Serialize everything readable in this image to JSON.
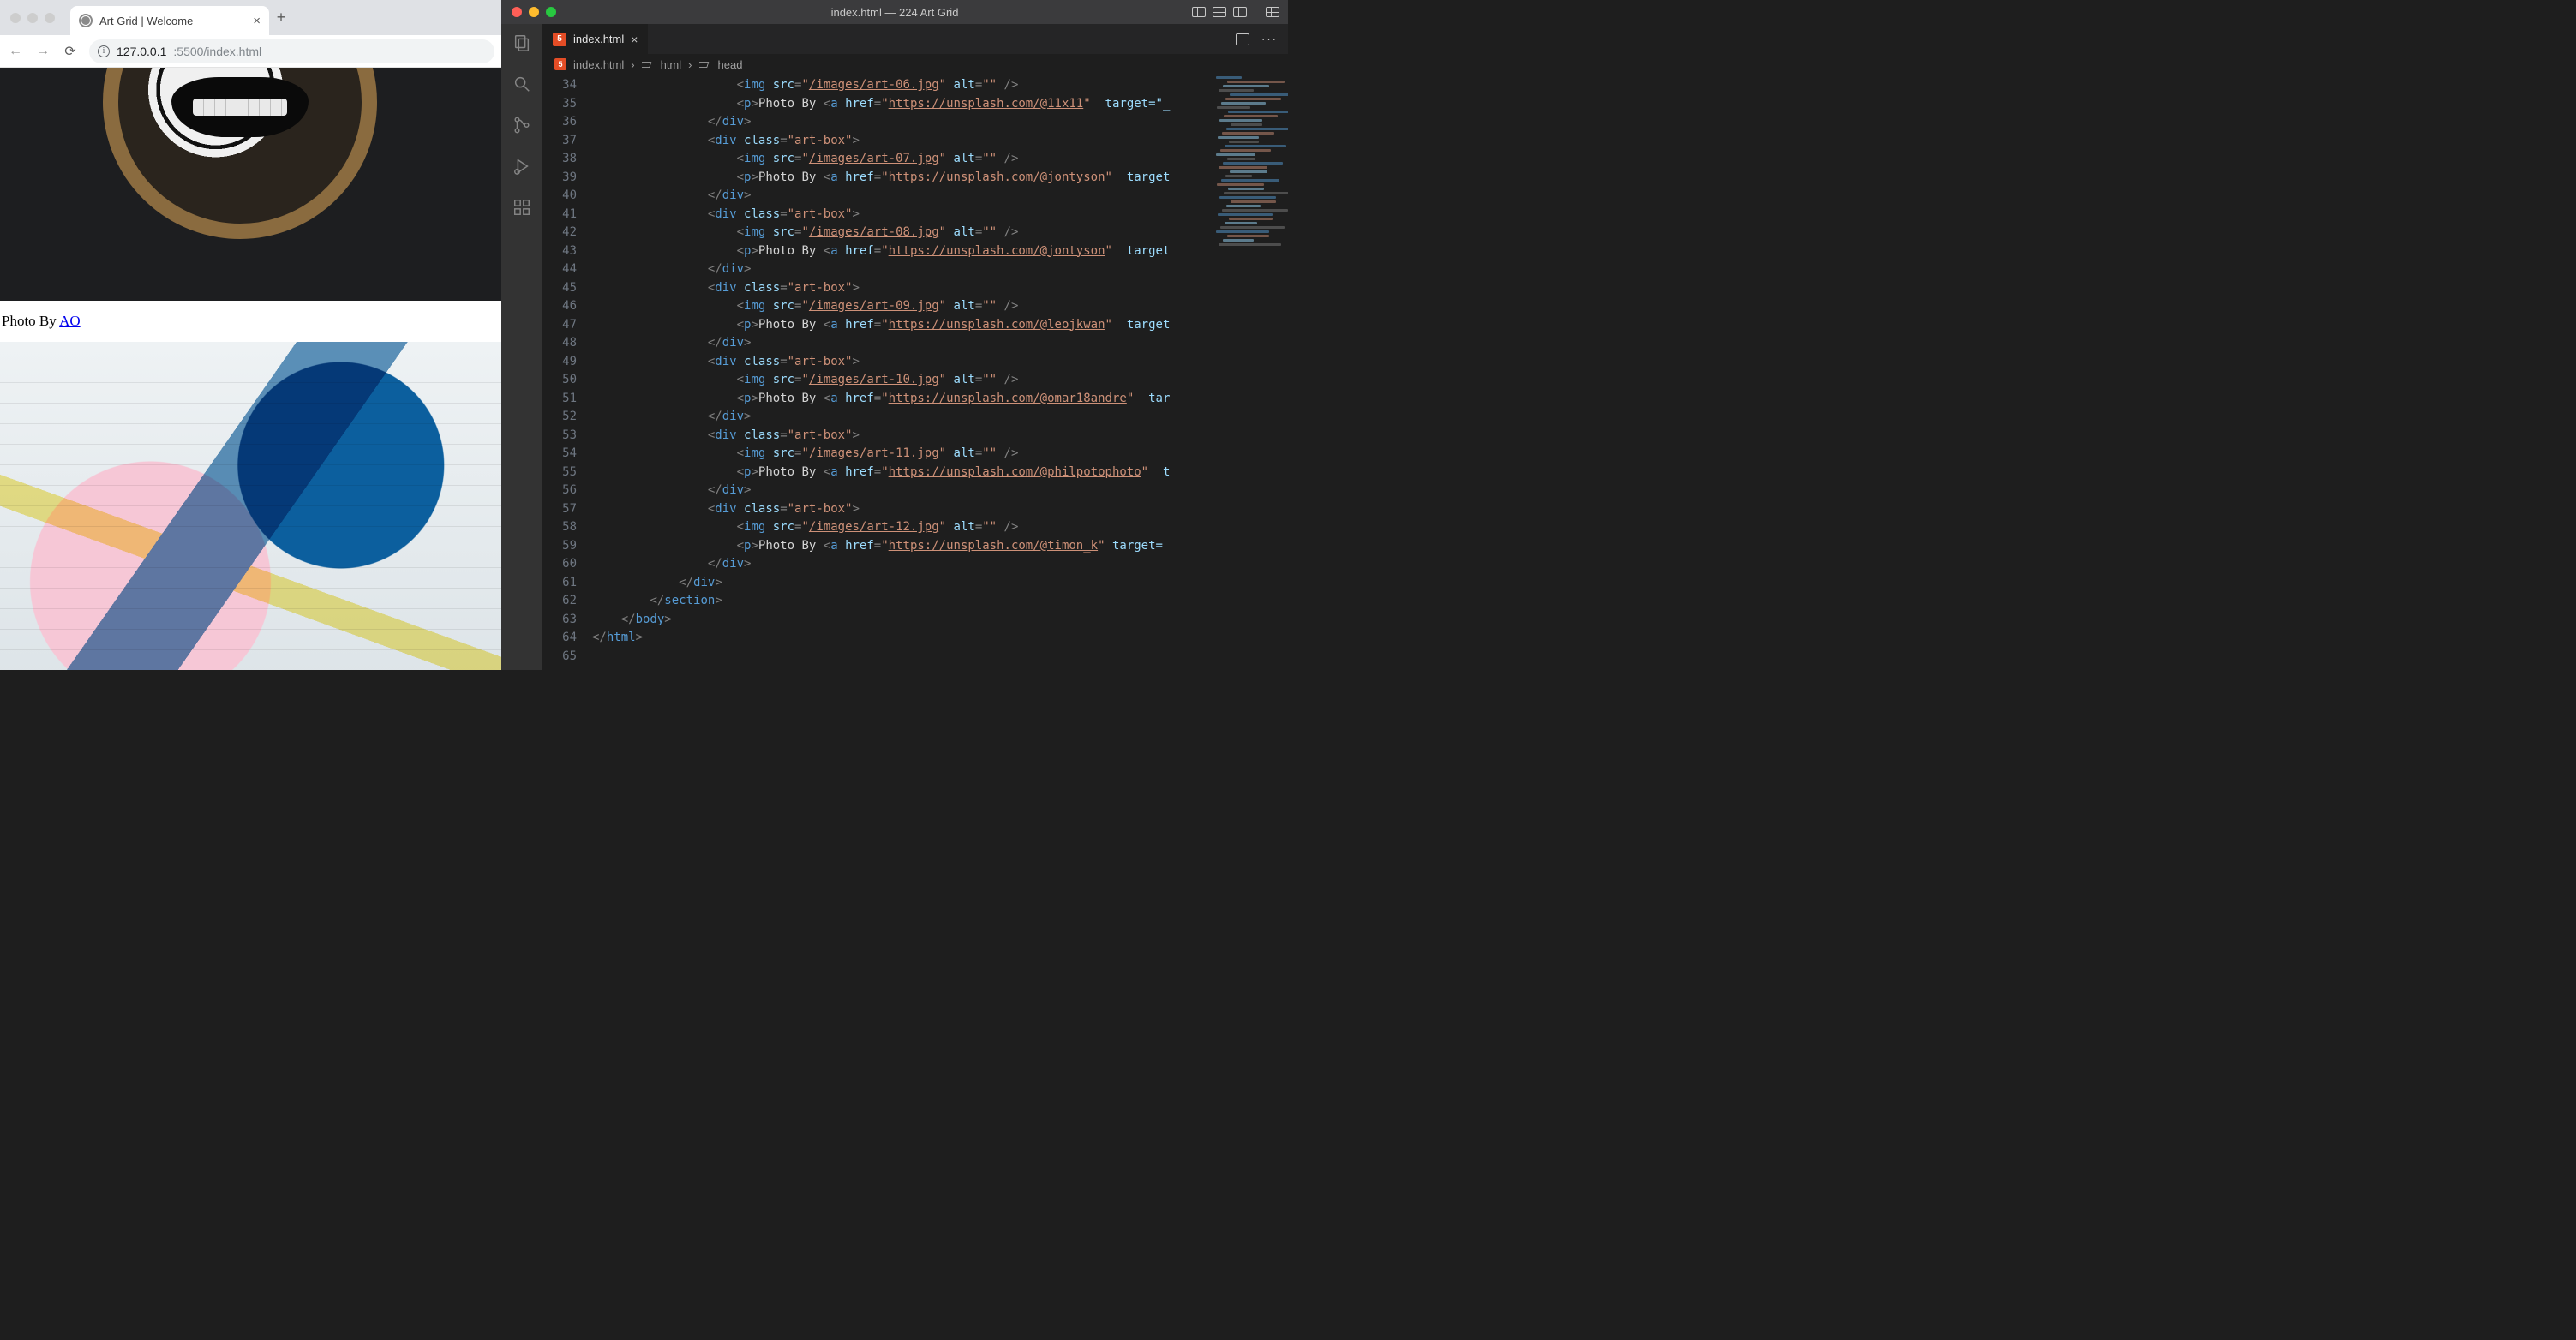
{
  "browser": {
    "tab_title": "Art Grid | Welcome",
    "address_host": "127.0.0.1",
    "address_port_path": ":5500/index.html",
    "caption_prefix": "Photo By ",
    "caption_link_text": "AO"
  },
  "vscode": {
    "window_title": "index.html — 224 Art Grid",
    "traffic_colors": {
      "close": "#ff5f57",
      "min": "#febc2e",
      "max": "#28c840"
    },
    "tab_filename": "index.html",
    "breadcrumb": [
      "index.html",
      "html",
      "head"
    ],
    "line_start": 34,
    "line_end": 65,
    "lines": [
      {
        "indent": 5,
        "kind": "img",
        "src": "/images/art-06.jpg"
      },
      {
        "indent": 5,
        "kind": "p",
        "href": "https://unsplash.com/@11x11",
        "tail": "target=\"_"
      },
      {
        "indent": 4,
        "kind": "close",
        "tag": "div"
      },
      {
        "indent": 4,
        "kind": "open-artbox"
      },
      {
        "indent": 5,
        "kind": "img",
        "src": "/images/art-07.jpg"
      },
      {
        "indent": 5,
        "kind": "p",
        "href": "https://unsplash.com/@jontyson",
        "tail": "target"
      },
      {
        "indent": 4,
        "kind": "close",
        "tag": "div"
      },
      {
        "indent": 4,
        "kind": "open-artbox"
      },
      {
        "indent": 5,
        "kind": "img",
        "src": "/images/art-08.jpg"
      },
      {
        "indent": 5,
        "kind": "p",
        "href": "https://unsplash.com/@jontyson",
        "tail": "target"
      },
      {
        "indent": 4,
        "kind": "close",
        "tag": "div"
      },
      {
        "indent": 4,
        "kind": "open-artbox"
      },
      {
        "indent": 5,
        "kind": "img",
        "src": "/images/art-09.jpg"
      },
      {
        "indent": 5,
        "kind": "p",
        "href": "https://unsplash.com/@leojkwan",
        "tail": "target"
      },
      {
        "indent": 4,
        "kind": "close",
        "tag": "div"
      },
      {
        "indent": 4,
        "kind": "open-artbox"
      },
      {
        "indent": 5,
        "kind": "img",
        "src": "/images/art-10.jpg"
      },
      {
        "indent": 5,
        "kind": "p",
        "href": "https://unsplash.com/@omar18andre",
        "tail": "tar"
      },
      {
        "indent": 4,
        "kind": "close",
        "tag": "div"
      },
      {
        "indent": 4,
        "kind": "open-artbox"
      },
      {
        "indent": 5,
        "kind": "img",
        "src": "/images/art-11.jpg"
      },
      {
        "indent": 5,
        "kind": "p",
        "href": "https://unsplash.com/@philpotophoto",
        "tail": "t"
      },
      {
        "indent": 4,
        "kind": "close",
        "tag": "div"
      },
      {
        "indent": 4,
        "kind": "open-artbox"
      },
      {
        "indent": 5,
        "kind": "img",
        "src": "/images/art-12.jpg"
      },
      {
        "indent": 5,
        "kind": "p2",
        "href": "https://unsplash.com/@timon_k",
        "tail": "target="
      },
      {
        "indent": 4,
        "kind": "close",
        "tag": "div"
      },
      {
        "indent": 3,
        "kind": "close",
        "tag": "div"
      },
      {
        "indent": 2,
        "kind": "close",
        "tag": "section"
      },
      {
        "indent": 1,
        "kind": "close",
        "tag": "body"
      },
      {
        "indent": 0,
        "kind": "close",
        "tag": "html"
      },
      {
        "indent": 0,
        "kind": "blank"
      }
    ]
  }
}
